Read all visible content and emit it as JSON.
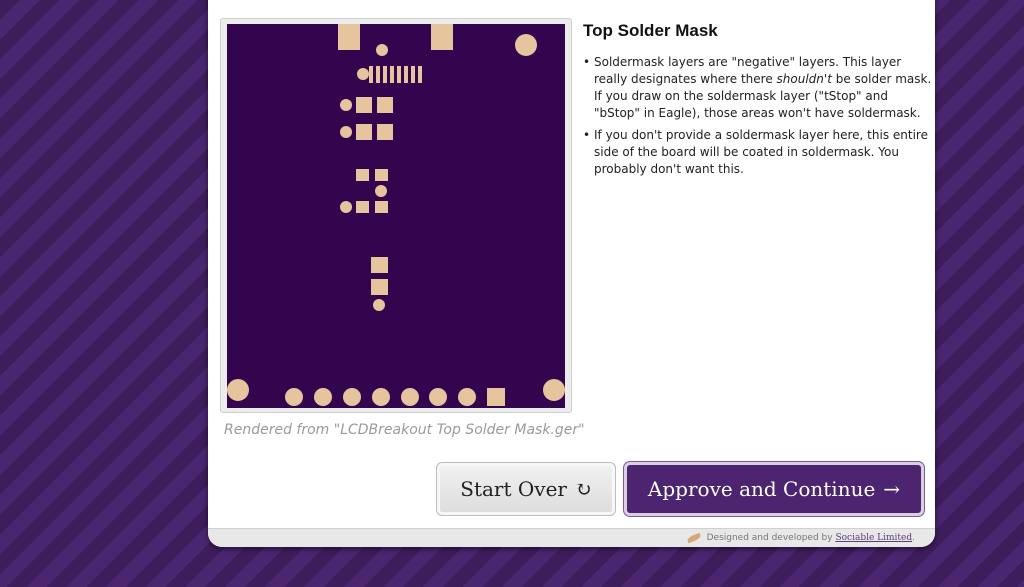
{
  "layer": {
    "title": "Top Solder Mask",
    "caption": "Rendered from \"LCDBreakout Top Solder Mask.ger\"",
    "notes": [
      {
        "before": "Soldermask layers are \"negative\" layers. This layer really designates where there ",
        "emphasis": "shouldn't",
        "after": " be solder mask. If you draw on the soldermask layer (\"tStop\" and \"bStop\" in Eagle), those areas won't have soldermask."
      },
      {
        "before": "If you don't provide a soldermask layer here, this entire side of the board will be coated in soldermask. You probably don't want this.",
        "emphasis": "",
        "after": ""
      }
    ]
  },
  "buttons": {
    "start_over": "Start Over",
    "start_over_icon": "↻",
    "approve": "Approve and Continue",
    "approve_icon": "→"
  },
  "footer": {
    "prefix": "Designed and developed by",
    "company": "Sociable Limited",
    "suffix": "."
  },
  "colors": {
    "board": "#33054f",
    "pad": "#e6c49d",
    "approve_button": "#4c2470",
    "background_stripe_a": "#3d1d5c",
    "background_stripe_b": "#4a2670"
  }
}
